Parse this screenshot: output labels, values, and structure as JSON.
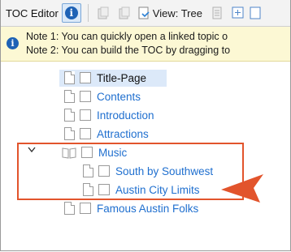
{
  "toolbar": {
    "title": "TOC Editor",
    "view_label": "View: Tree",
    "icons": [
      "info-icon",
      "link-icon",
      "unlink-icon",
      "page-icon",
      "view-tree-icon",
      "list-icon",
      "expand-icon",
      "window-icon"
    ]
  },
  "notes": {
    "line1": "Note 1: You can quickly open a linked topic o",
    "line2": "Note 2: You can build the TOC by dragging to"
  },
  "tree": {
    "items": [
      {
        "label": "Title-Page"
      },
      {
        "label": "Contents"
      },
      {
        "label": "Introduction"
      },
      {
        "label": "Attractions"
      },
      {
        "label": "Music"
      },
      {
        "label": "South by Southwest"
      },
      {
        "label": "Austin City Limits"
      },
      {
        "label": "Famous Austin Folks"
      }
    ]
  },
  "colors": {
    "link": "#1f6fcf",
    "highlight": "#e2542c",
    "note_bg": "#fcf8d4",
    "selection_bg": "#dce9f9"
  }
}
